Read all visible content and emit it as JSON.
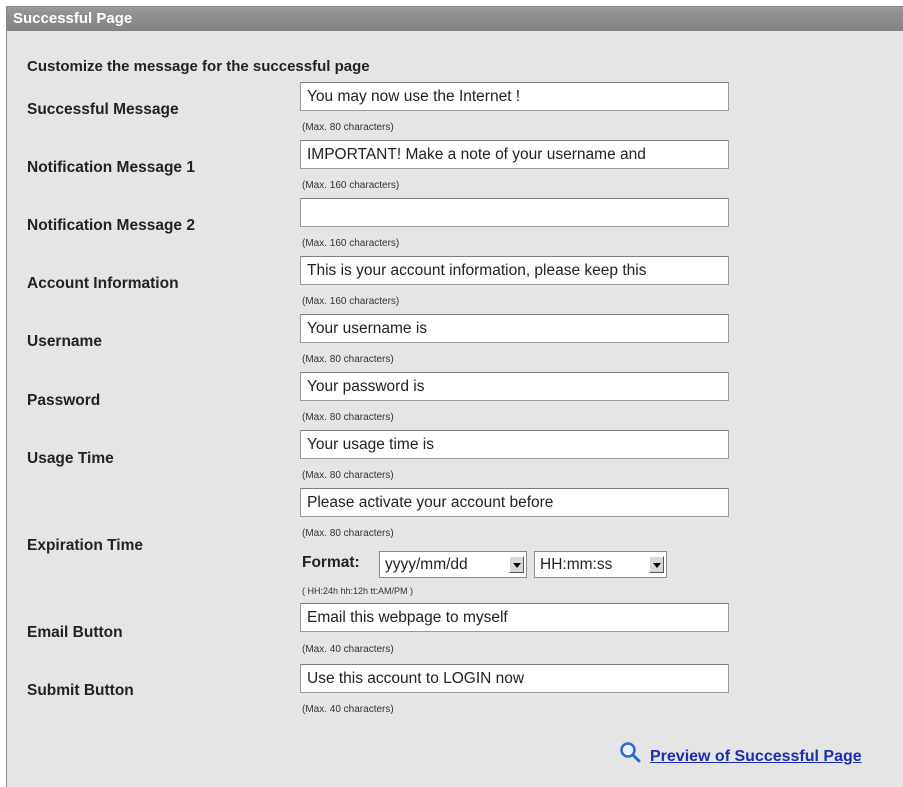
{
  "panel": {
    "title": "Successful Page",
    "intro": "Customize the message for the successful page"
  },
  "fields": {
    "successful_message": {
      "label": "Successful Message",
      "value": "You may now use the Internet !",
      "hint": "(Max. 80 characters)"
    },
    "notification_1": {
      "label": "Notification Message 1",
      "value": "IMPORTANT! Make a note of your username and",
      "hint": "(Max. 160 characters)"
    },
    "notification_2": {
      "label": "Notification Message 2",
      "value": "",
      "hint": "(Max. 160 characters)"
    },
    "account_info": {
      "label": "Account Information",
      "value": "This is your account information, please keep this",
      "hint": "(Max. 160 characters)"
    },
    "username": {
      "label": "Username",
      "value": "Your username is",
      "hint": "(Max. 80 characters)"
    },
    "password": {
      "label": "Password",
      "value": "Your password is",
      "hint": "(Max. 80 characters)"
    },
    "usage_time": {
      "label": "Usage Time",
      "value": "Your usage time is",
      "hint": "(Max. 80 characters)"
    },
    "expiration_time": {
      "label": "Expiration Time",
      "value": "Please activate your account before",
      "hint": "(Max. 80 characters)",
      "format_label": "Format:",
      "date_format": "yyyy/mm/dd",
      "time_format": "HH:mm:ss",
      "format_hint": "( HH:24h hh:12h tt:AM/PM )"
    },
    "email_button": {
      "label": "Email Button",
      "value": "Email this webpage to myself",
      "hint": "(Max. 40 characters)"
    },
    "submit_button": {
      "label": "Submit Button",
      "value": "Use this account to LOGIN now",
      "hint": "(Max. 40 characters)"
    }
  },
  "preview": {
    "label": "Preview of Successful Page",
    "icon": "magnifier-icon"
  },
  "colors": {
    "title_bar": "#8c8c8c",
    "panel_bg": "#e5e5e5",
    "link": "#1a2fb0"
  }
}
